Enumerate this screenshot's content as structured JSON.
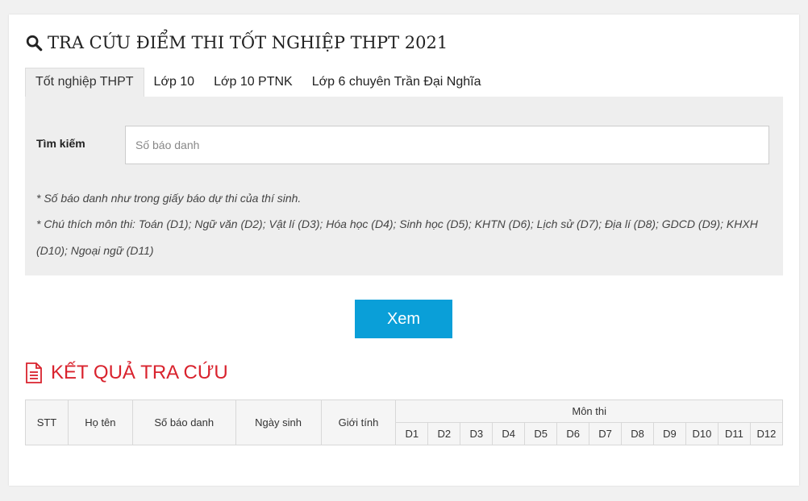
{
  "page": {
    "title": "TRA CỨU ĐIỂM THI TỐT NGHIỆP THPT 2021"
  },
  "tabs": [
    {
      "label": "Tốt nghiệp THPT",
      "active": true
    },
    {
      "label": "Lớp 10",
      "active": false
    },
    {
      "label": "Lớp 10 PTNK",
      "active": false
    },
    {
      "label": "Lớp 6 chuyên Trần Đại Nghĩa",
      "active": false
    }
  ],
  "search": {
    "label": "Tìm kiếm",
    "placeholder": "Số báo danh",
    "value": ""
  },
  "notes": {
    "sbd": "* Số báo danh như trong giấy báo dự thi của thí sinh.",
    "subjects": "* Chú thích môn thi: Toán (D1); Ngữ văn (D2); Vật lí (D3); Hóa học (D4); Sinh học (D5); KHTN (D6); Lịch sử (D7); Địa lí (D8); GDCD (D9); KHXH (D10); Ngoại ngữ (D11)"
  },
  "submit": {
    "label": "Xem"
  },
  "results": {
    "title": "KẾT QUẢ TRA CỨU",
    "columns": {
      "stt": "STT",
      "name": "Họ tên",
      "sbd": "Số báo danh",
      "dob": "Ngày sinh",
      "gender": "Giới tính",
      "subjects": "Môn thi"
    },
    "subject_codes": [
      "D1",
      "D2",
      "D3",
      "D4",
      "D5",
      "D6",
      "D7",
      "D8",
      "D9",
      "D10",
      "D11",
      "D12"
    ]
  },
  "colors": {
    "accent_button": "#0a9fd8",
    "result_title": "#d9232e",
    "panel_bg": "#eeeeee"
  },
  "icons": {
    "title": "search-icon",
    "results": "document-icon"
  }
}
